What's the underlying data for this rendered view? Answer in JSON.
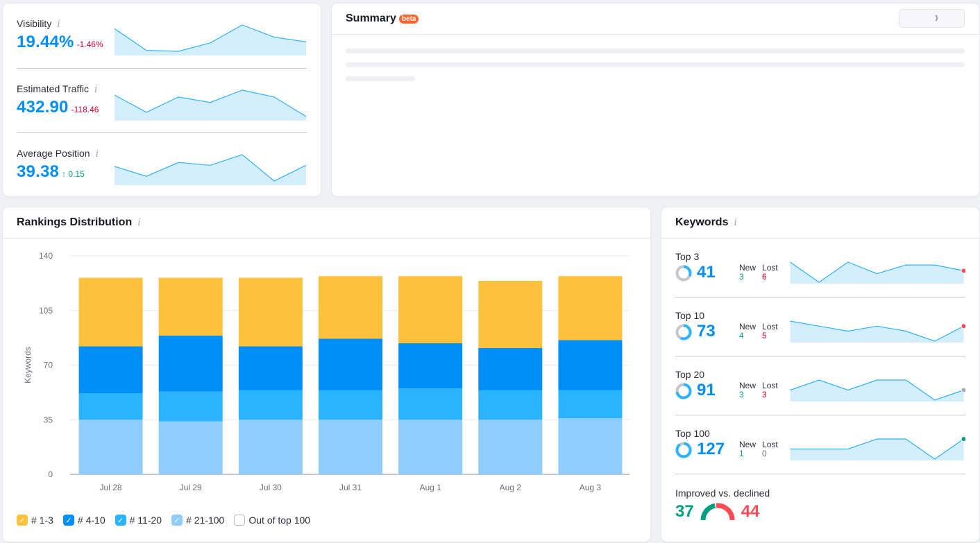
{
  "metrics": [
    {
      "label": "Visibility",
      "value": "19.44%",
      "delta": "-1.46%",
      "delta_dir": "neg",
      "spark": [
        19.9,
        17.6,
        17.5,
        18.4,
        20.3,
        19.0,
        18.5
      ]
    },
    {
      "label": "Estimated Traffic",
      "value": "432.90",
      "delta": "-118.46",
      "delta_dir": "neg",
      "spark": [
        520,
        450,
        512,
        490,
        540,
        512,
        432.9
      ]
    },
    {
      "label": "Average Position",
      "value": "39.38",
      "delta": "↑ 0.15",
      "delta_dir": "pos",
      "spark": [
        39.35,
        39.1,
        39.45,
        39.38,
        39.65,
        38.98,
        39.38
      ]
    }
  ],
  "summary": {
    "title": "Summary",
    "badge": "beta"
  },
  "rankings": {
    "title": "Rankings Distribution",
    "legend": [
      {
        "label": "# 1-3",
        "color": "#fdc13b",
        "checked": true
      },
      {
        "label": "# 4-10",
        "color": "#008ff8",
        "checked": true
      },
      {
        "label": "# 11-20",
        "color": "#2bb3ff",
        "checked": true
      },
      {
        "label": "# 21-100",
        "color": "#8fcdff",
        "checked": true
      },
      {
        "label": "Out of top 100",
        "color": "#ffffff",
        "checked": false
      }
    ]
  },
  "chart_data": {
    "type": "bar",
    "stacked": true,
    "title": "Rankings Distribution",
    "xlabel": "",
    "ylabel": "Keywords",
    "ylim": [
      0,
      140
    ],
    "yticks": [
      0,
      35,
      70,
      105,
      140
    ],
    "grid": true,
    "legend_position": "bottom-left",
    "categories": [
      "Jul 28",
      "Jul 29",
      "Jul 30",
      "Jul 31",
      "Aug 1",
      "Aug 2",
      "Aug 3"
    ],
    "series": [
      {
        "name": "# 21-100",
        "color": "#8fcdff",
        "values": [
          35,
          34,
          35,
          35,
          35,
          35,
          36
        ]
      },
      {
        "name": "# 11-20",
        "color": "#2bb3ff",
        "values": [
          17,
          19,
          19,
          19,
          20,
          19,
          18
        ]
      },
      {
        "name": "# 4-10",
        "color": "#008ff8",
        "values": [
          30,
          36,
          28,
          33,
          29,
          27,
          32
        ]
      },
      {
        "name": "# 1-3",
        "color": "#fdc13b",
        "values": [
          44,
          37,
          44,
          40,
          43,
          43,
          41
        ]
      }
    ]
  },
  "keywords": {
    "title": "Keywords",
    "new_label": "New",
    "lost_label": "Lost",
    "rows": [
      {
        "label": "Top 3",
        "value": "41",
        "share": 0.32,
        "new": "3",
        "lost": "6",
        "new_class": "pos",
        "lost_class": "neg",
        "dot_color": "#ff4953",
        "spark": [
          44,
          37,
          44,
          40,
          43,
          43,
          41
        ]
      },
      {
        "label": "Top 10",
        "value": "73",
        "share": 0.57,
        "new": "4",
        "lost": "5",
        "new_class": "pos",
        "lost_class": "neg",
        "dot_color": "#ff4953",
        "spark": [
          74,
          73,
          72,
          73,
          72,
          70,
          73
        ]
      },
      {
        "label": "Top 20",
        "value": "91",
        "share": 0.72,
        "new": "3",
        "lost": "3",
        "new_class": "pos",
        "lost_class": "neg",
        "dot_color": "#a8a9b1",
        "spark": [
          91,
          93,
          91,
          93,
          93,
          89,
          91
        ]
      },
      {
        "label": "Top 100",
        "value": "127",
        "share": 0.9,
        "new": "1",
        "lost": "0",
        "new_class": "pos",
        "lost_class": "neutral",
        "dot_color": "#009f81",
        "spark": [
          126,
          126,
          126,
          127,
          127,
          125,
          127
        ]
      }
    ],
    "improved_label": "Improved vs. declined",
    "improved": 37,
    "declined": 44,
    "improved_color": "#009f81",
    "declined_color": "#ff4953"
  }
}
